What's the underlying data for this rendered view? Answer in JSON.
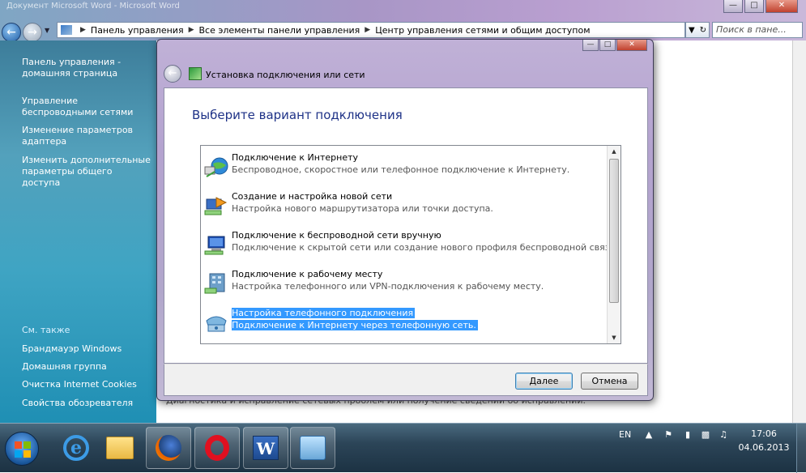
{
  "window": {
    "title_blur": "Документ Microsoft Word - Microsoft Word"
  },
  "address": {
    "crumbs": [
      "Панель управления",
      "Все элементы панели управления",
      "Центр управления сетями и общим доступом"
    ],
    "search_placeholder": "Поиск в пане..."
  },
  "sidebar": {
    "top_links": [
      "Панель управления - домашняя страница",
      "Управление беспроводными сетями",
      "Изменение параметров адаптера",
      "Изменить дополнительные параметры общего доступа"
    ],
    "see_also_title": "См. также",
    "see_also": [
      "Брандмауэр Windows",
      "Домашняя группа",
      "Очистка Internet Cookies",
      "Свойства обозревателя"
    ]
  },
  "content": {
    "bottom_text": "Диагностика и исправление сетевых проблем или получение сведений об исправлении."
  },
  "dialog": {
    "title": "Установка подключения или сети",
    "heading": "Выберите вариант подключения",
    "options": [
      {
        "title": "Подключение к Интернету",
        "desc": "Беспроводное, скоростное или телефонное подключение к Интернету.",
        "icon": "globe-network-icon"
      },
      {
        "title": "Создание и настройка новой сети",
        "desc": "Настройка нового маршрутизатора или точки доступа.",
        "icon": "router-setup-icon"
      },
      {
        "title": "Подключение к беспроводной сети вручную",
        "desc": "Подключение к скрытой сети или создание нового профиля беспроводной связи.",
        "icon": "wireless-computer-icon"
      },
      {
        "title": "Подключение к рабочему месту",
        "desc": "Настройка телефонного или VPN-подключения к рабочему месту.",
        "icon": "workplace-icon"
      },
      {
        "title": "Настройка телефонного подключения",
        "desc": "Подключение к Интернету через телефонную сеть.",
        "icon": "dialup-modem-icon"
      }
    ],
    "next_label": "Далее",
    "cancel_label": "Отмена"
  },
  "taskbar": {
    "language": "EN",
    "time": "17:06",
    "date": "04.06.2013"
  }
}
